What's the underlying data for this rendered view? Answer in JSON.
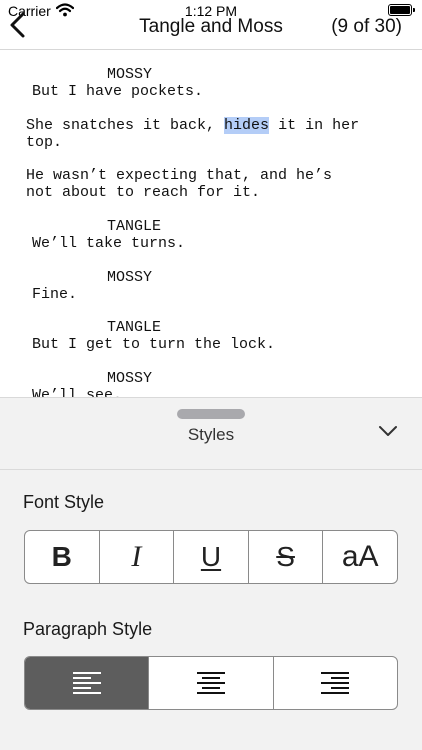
{
  "status": {
    "carrier": "Carrier",
    "time": "1:12 PM"
  },
  "nav": {
    "title": "Tangle and Moss",
    "page_count": "(9 of 30)"
  },
  "script_lines": [
    {
      "text": "MOSSY"
    },
    {
      "text": "But I have pockets."
    },
    {
      "before": "She snatches it back, ",
      "highlight": "hides",
      "after": " it in her"
    },
    {
      "text": "top."
    },
    {
      "text": "He wasn’t expecting that, and he’s"
    },
    {
      "text": "not about to reach for it."
    },
    {
      "text": "TANGLE"
    },
    {
      "text": "We’ll take turns."
    },
    {
      "text": "MOSSY"
    },
    {
      "text": "Fine."
    },
    {
      "text": "TANGLE"
    },
    {
      "text": "But I get to turn the lock."
    },
    {
      "text": "MOSSY"
    },
    {
      "text": "We’ll see."
    }
  ],
  "panel": {
    "title": "Styles",
    "font_style_label": "Font Style",
    "paragraph_style_label": "Paragraph Style",
    "font_buttons": [
      {
        "glyph": "B",
        "icon": "bold-icon"
      },
      {
        "glyph": "I",
        "icon": "italic-icon"
      },
      {
        "glyph": "U",
        "icon": "underline-icon"
      },
      {
        "glyph": "S",
        "icon": "strikethrough-icon"
      },
      {
        "glyph": "aA",
        "icon": "case-icon"
      }
    ],
    "paragraph_buttons": [
      {
        "icon": "align-left-icon",
        "selected": true
      },
      {
        "icon": "align-center-icon",
        "selected": false
      },
      {
        "icon": "align-right-icon",
        "selected": false
      }
    ]
  },
  "colors": {
    "highlight": "#b4cdf7",
    "selected_segment": "#5d5d5d",
    "panel_bg": "#f2f2f2"
  }
}
